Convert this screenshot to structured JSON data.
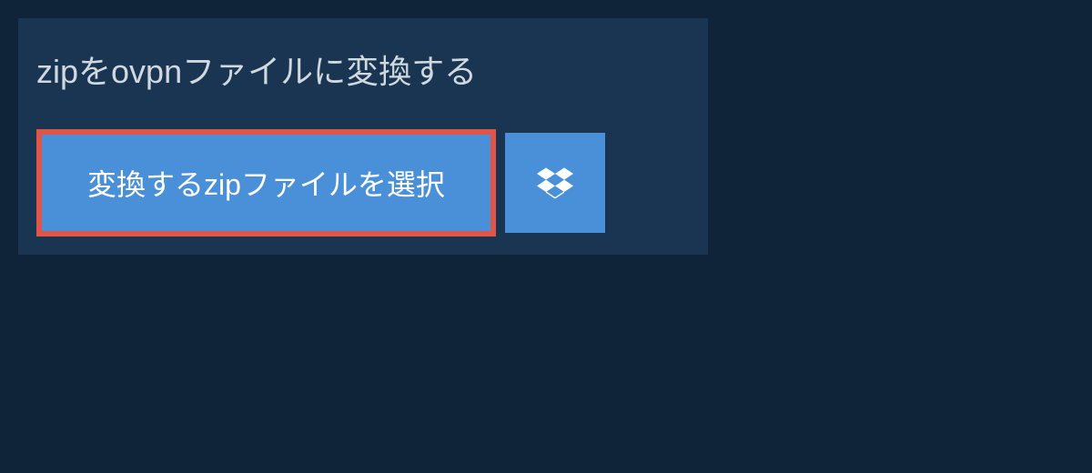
{
  "heading": "zipをovpnファイルに変換する",
  "select_button_label": "変換するzipファイルを選択",
  "colors": {
    "background": "#0f2438",
    "panel": "#1a3552",
    "button": "#4a90d9",
    "highlight_border": "#e05548"
  }
}
